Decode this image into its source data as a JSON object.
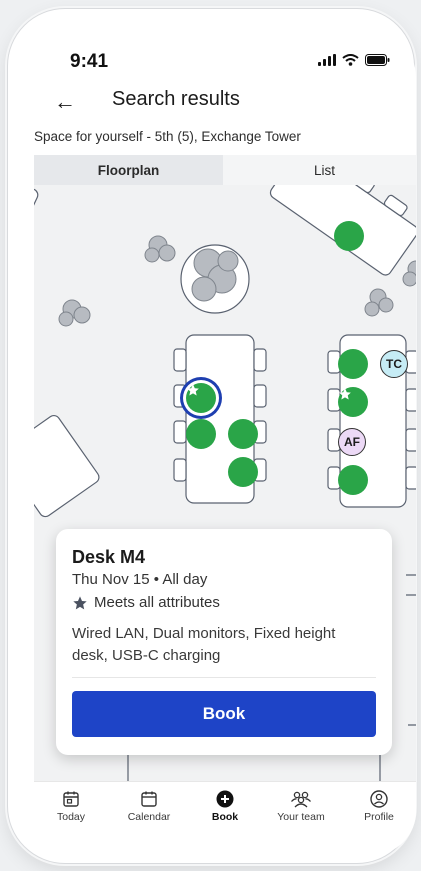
{
  "status": {
    "time": "9:41"
  },
  "header": {
    "title": "Search results"
  },
  "subtitle": "Space for yourself - 5th (5), Exchange Tower",
  "tabs": [
    {
      "label": "Floorplan",
      "active": true
    },
    {
      "label": "List",
      "active": false
    }
  ],
  "map": {
    "avatars": [
      {
        "initials": "TC",
        "color": "#c6ecf5"
      },
      {
        "initials": "AF",
        "color": "#ecd9f6"
      }
    ],
    "seat_color": "#2aa548",
    "selected_ring_color": "#1e3fb0"
  },
  "card": {
    "title": "Desk M4",
    "date": "Thu Nov 15",
    "time": "All day",
    "attributes": "Meets all attributes",
    "features": "Wired LAN, Dual monitors, Fixed height desk, USB-C charging",
    "book_label": "Book",
    "book_color": "#1e44c7"
  },
  "nav": [
    {
      "label": "Today",
      "icon": "calendar-day-icon"
    },
    {
      "label": "Calendar",
      "icon": "calendar-icon"
    },
    {
      "label": "Book",
      "icon": "plus-circle-icon",
      "active": true
    },
    {
      "label": "Your team",
      "icon": "team-icon"
    },
    {
      "label": "Profile",
      "icon": "profile-icon"
    }
  ]
}
